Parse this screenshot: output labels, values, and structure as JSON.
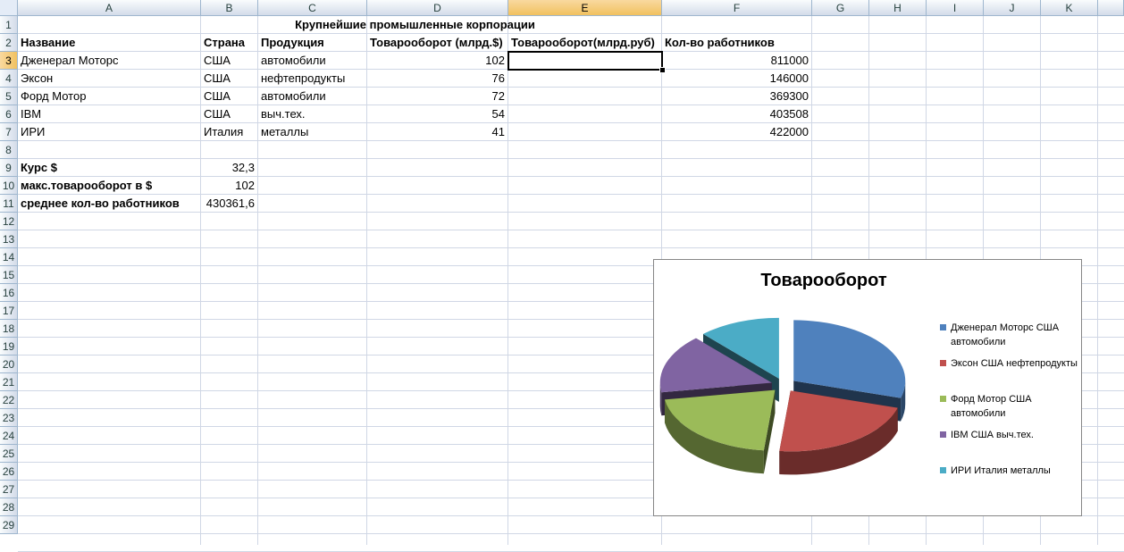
{
  "columns": [
    "A",
    "B",
    "C",
    "D",
    "E",
    "F",
    "G",
    "H",
    "I",
    "J",
    "K"
  ],
  "rows": [
    "1",
    "2",
    "3",
    "4",
    "5",
    "6",
    "7",
    "8",
    "9",
    "10",
    "11",
    "12",
    "13",
    "14",
    "15",
    "16",
    "17",
    "18",
    "19",
    "20",
    "21",
    "22",
    "23",
    "24",
    "25",
    "26",
    "27",
    "28",
    "29"
  ],
  "sheet": {
    "title": "Крупнейшие промышленные корпорации",
    "headers": {
      "name": "Название",
      "country": "Страна",
      "product": "Продукция",
      "turnover_usd": "Товарооборот (млрд.$)",
      "turnover_rub": "Товарооборот(млрд.руб)",
      "employees": "Кол-во работников"
    },
    "data_rows": [
      {
        "name": "Дженерал Моторс",
        "country": "США",
        "product": "автомобили",
        "usd": "102",
        "emp": "811000"
      },
      {
        "name": "Эксон",
        "country": "США",
        "product": "нефтепродукты",
        "usd": "76",
        "emp": "146000"
      },
      {
        "name": "Форд Мотор",
        "country": "США",
        "product": "автомобили",
        "usd": "72",
        "emp": "369300"
      },
      {
        "name": "IBM",
        "country": "США",
        "product": "выч.тех.",
        "usd": "54",
        "emp": "403508"
      },
      {
        "name": "ИРИ",
        "country": "Италия",
        "product": "металлы",
        "usd": "41",
        "emp": "422000"
      }
    ],
    "rate_label": "Курс $",
    "rate_value": "32,3",
    "max_label": "макс.товарооборот в $",
    "max_value": "102",
    "avg_label": "среднее кол-во работников",
    "avg_value": "430361,6"
  },
  "chart_data": {
    "type": "pie",
    "title": "Товарооборот",
    "categories": [
      "Дженерал Моторс США автомобили",
      "Эксон США нефтепродукты",
      "Форд Мотор США автомобили",
      "IBM США выч.тех.",
      "ИРИ Италия металлы"
    ],
    "values": [
      102,
      76,
      72,
      54,
      41
    ],
    "colors": [
      "#4f81bd",
      "#c0504d",
      "#9bbb59",
      "#8064a2",
      "#4bacc6"
    ],
    "legend_position": "right",
    "exploded": true,
    "style": "3d"
  }
}
